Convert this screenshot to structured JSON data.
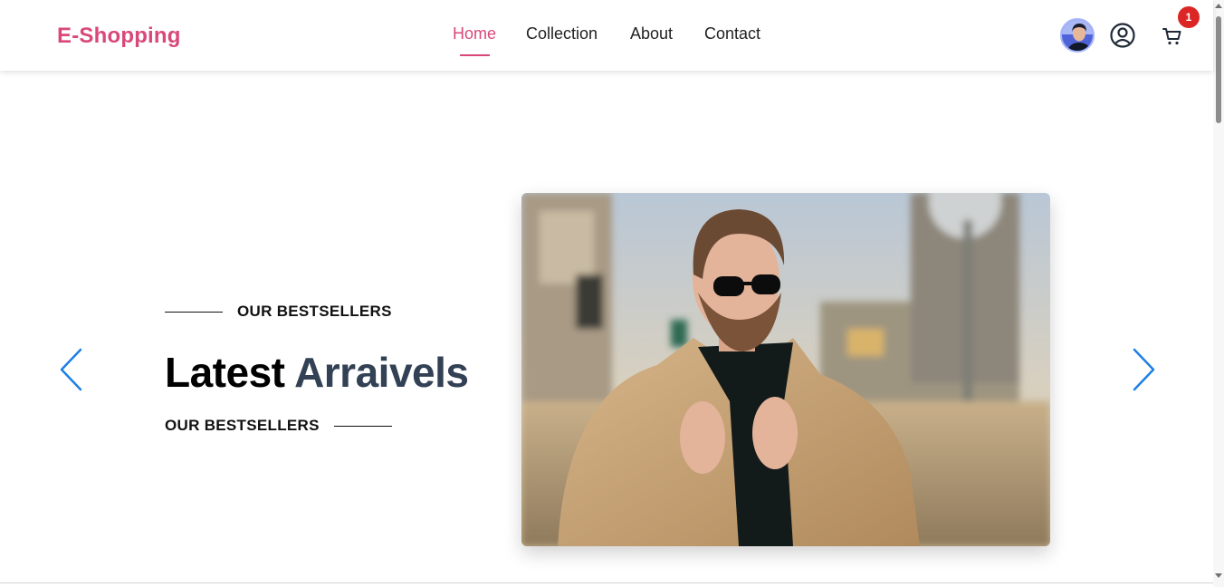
{
  "header": {
    "brand": "E-Shopping",
    "nav": [
      {
        "label": "Home",
        "active": true
      },
      {
        "label": "Collection",
        "active": false
      },
      {
        "label": "About",
        "active": false
      },
      {
        "label": "Contact",
        "active": false
      }
    ],
    "cart_count": "1",
    "icons": {
      "avatar": "user-avatar",
      "profile": "user-circle-icon",
      "cart": "cart-icon"
    }
  },
  "hero": {
    "eyebrow_top": "OUR BESTSELLERS",
    "headline_primary": "Latest",
    "headline_accent": "Arraivels",
    "eyebrow_bottom": "OUR BESTSELLERS",
    "prev_icon": "chevron-left-icon",
    "next_icon": "chevron-right-icon"
  },
  "colors": {
    "brand": "#d9487a",
    "headline_accent": "#334155",
    "arrows": "#1d7fe6",
    "badge": "#dc2626"
  }
}
